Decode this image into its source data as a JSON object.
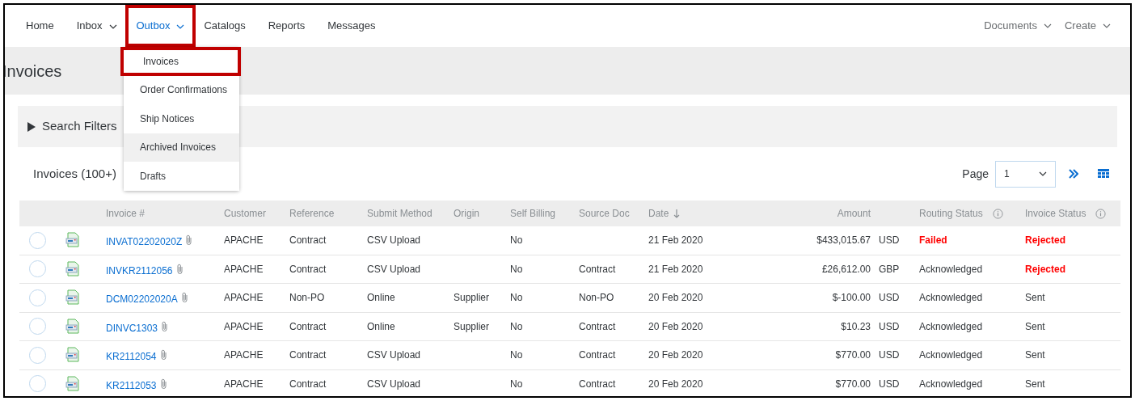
{
  "nav": {
    "left": [
      {
        "label": "Home",
        "kind": "link",
        "selected": false,
        "highlighted": false
      },
      {
        "label": "Inbox",
        "kind": "menu",
        "selected": false,
        "highlighted": false
      },
      {
        "label": "Outbox",
        "kind": "menu",
        "selected": true,
        "highlighted": true
      },
      {
        "label": "Catalogs",
        "kind": "link",
        "selected": false,
        "highlighted": false
      },
      {
        "label": "Reports",
        "kind": "link",
        "selected": false,
        "highlighted": false
      },
      {
        "label": "Messages",
        "kind": "link",
        "selected": false,
        "highlighted": false
      }
    ],
    "right": [
      {
        "label": "Documents",
        "kind": "menu"
      },
      {
        "label": "Create",
        "kind": "menu"
      }
    ]
  },
  "dropdown": {
    "items": [
      {
        "label": "Invoices",
        "hovered": false,
        "highlighted": true
      },
      {
        "label": "Order Confirmations",
        "hovered": false,
        "highlighted": false
      },
      {
        "label": "Ship Notices",
        "hovered": false,
        "highlighted": false
      },
      {
        "label": "Archived Invoices",
        "hovered": true,
        "highlighted": false
      },
      {
        "label": "Drafts",
        "hovered": false,
        "highlighted": false
      }
    ]
  },
  "page_title": "Invoices",
  "search_filters": {
    "label": "Search Filters",
    "expanded": false
  },
  "list": {
    "title": "Invoices (100+)",
    "page_label": "Page",
    "page_value": "1"
  },
  "table": {
    "columns": [
      {
        "label": "Invoice #",
        "kind": "plain"
      },
      {
        "label": "Customer",
        "kind": "plain"
      },
      {
        "label": "Reference",
        "kind": "plain"
      },
      {
        "label": "Submit Method",
        "kind": "plain"
      },
      {
        "label": "Origin",
        "kind": "plain"
      },
      {
        "label": "Self Billing",
        "kind": "plain"
      },
      {
        "label": "Source Doc",
        "kind": "plain"
      },
      {
        "label": "Date",
        "kind": "sorted"
      },
      {
        "label": "Amount",
        "kind": "amount"
      },
      {
        "label": "Routing Status",
        "kind": "info"
      },
      {
        "label": "Invoice Status",
        "kind": "info"
      }
    ],
    "rows": [
      {
        "selected": false,
        "invoice": "INVAT02202020Z",
        "customer": "APACHE",
        "reference": "Contract",
        "submit_method": "CSV Upload",
        "self_billing": "No",
        "date": "21 Feb 2020",
        "amount": "$433,015.67",
        "currency": "USD",
        "routing_status": "Failed",
        "routing_alert": true,
        "invoice_status": "Rejected",
        "invoice_alert": true
      },
      {
        "selected": false,
        "invoice": "INVKR2112056",
        "customer": "APACHE",
        "reference": "Contract",
        "submit_method": "CSV Upload",
        "self_billing": "No",
        "source_doc": "Contract",
        "date": "21 Feb 2020",
        "amount": "£26,612.00",
        "currency": "GBP",
        "routing_status": "Acknowledged",
        "routing_alert": false,
        "invoice_status": "Rejected",
        "invoice_alert": true
      },
      {
        "selected": false,
        "invoice": "DCM02202020A",
        "customer": "APACHE",
        "reference": "Non-PO",
        "submit_method": "Online",
        "origin": "Supplier",
        "self_billing": "No",
        "source_doc": "Non-PO",
        "date": "20 Feb 2020",
        "amount": "$-100.00",
        "currency": "USD",
        "routing_status": "Acknowledged",
        "routing_alert": false,
        "invoice_status": "Sent",
        "invoice_alert": false
      },
      {
        "selected": false,
        "invoice": "DINVC1303",
        "customer": "APACHE",
        "reference": "Contract",
        "submit_method": "Online",
        "origin": "Supplier",
        "self_billing": "No",
        "source_doc": "Contract",
        "date": "20 Feb 2020",
        "amount": "$10.23",
        "currency": "USD",
        "routing_status": "Acknowledged",
        "routing_alert": false,
        "invoice_status": "Sent",
        "invoice_alert": false
      },
      {
        "selected": false,
        "invoice": "KR2112054",
        "customer": "APACHE",
        "reference": "Contract",
        "submit_method": "CSV Upload",
        "self_billing": "No",
        "source_doc": "Contract",
        "date": "20 Feb 2020",
        "amount": "$770.00",
        "currency": "USD",
        "routing_status": "Acknowledged",
        "routing_alert": false,
        "invoice_status": "Sent",
        "invoice_alert": false
      },
      {
        "selected": false,
        "invoice": "KR2112053",
        "customer": "APACHE",
        "reference": "Contract",
        "submit_method": "CSV Upload",
        "self_billing": "No",
        "source_doc": "Contract",
        "date": "20 Feb 2020",
        "amount": "$770.00",
        "currency": "USD",
        "routing_status": "Acknowledged",
        "routing_alert": false,
        "invoice_status": "Sent",
        "invoice_alert": false
      }
    ]
  }
}
